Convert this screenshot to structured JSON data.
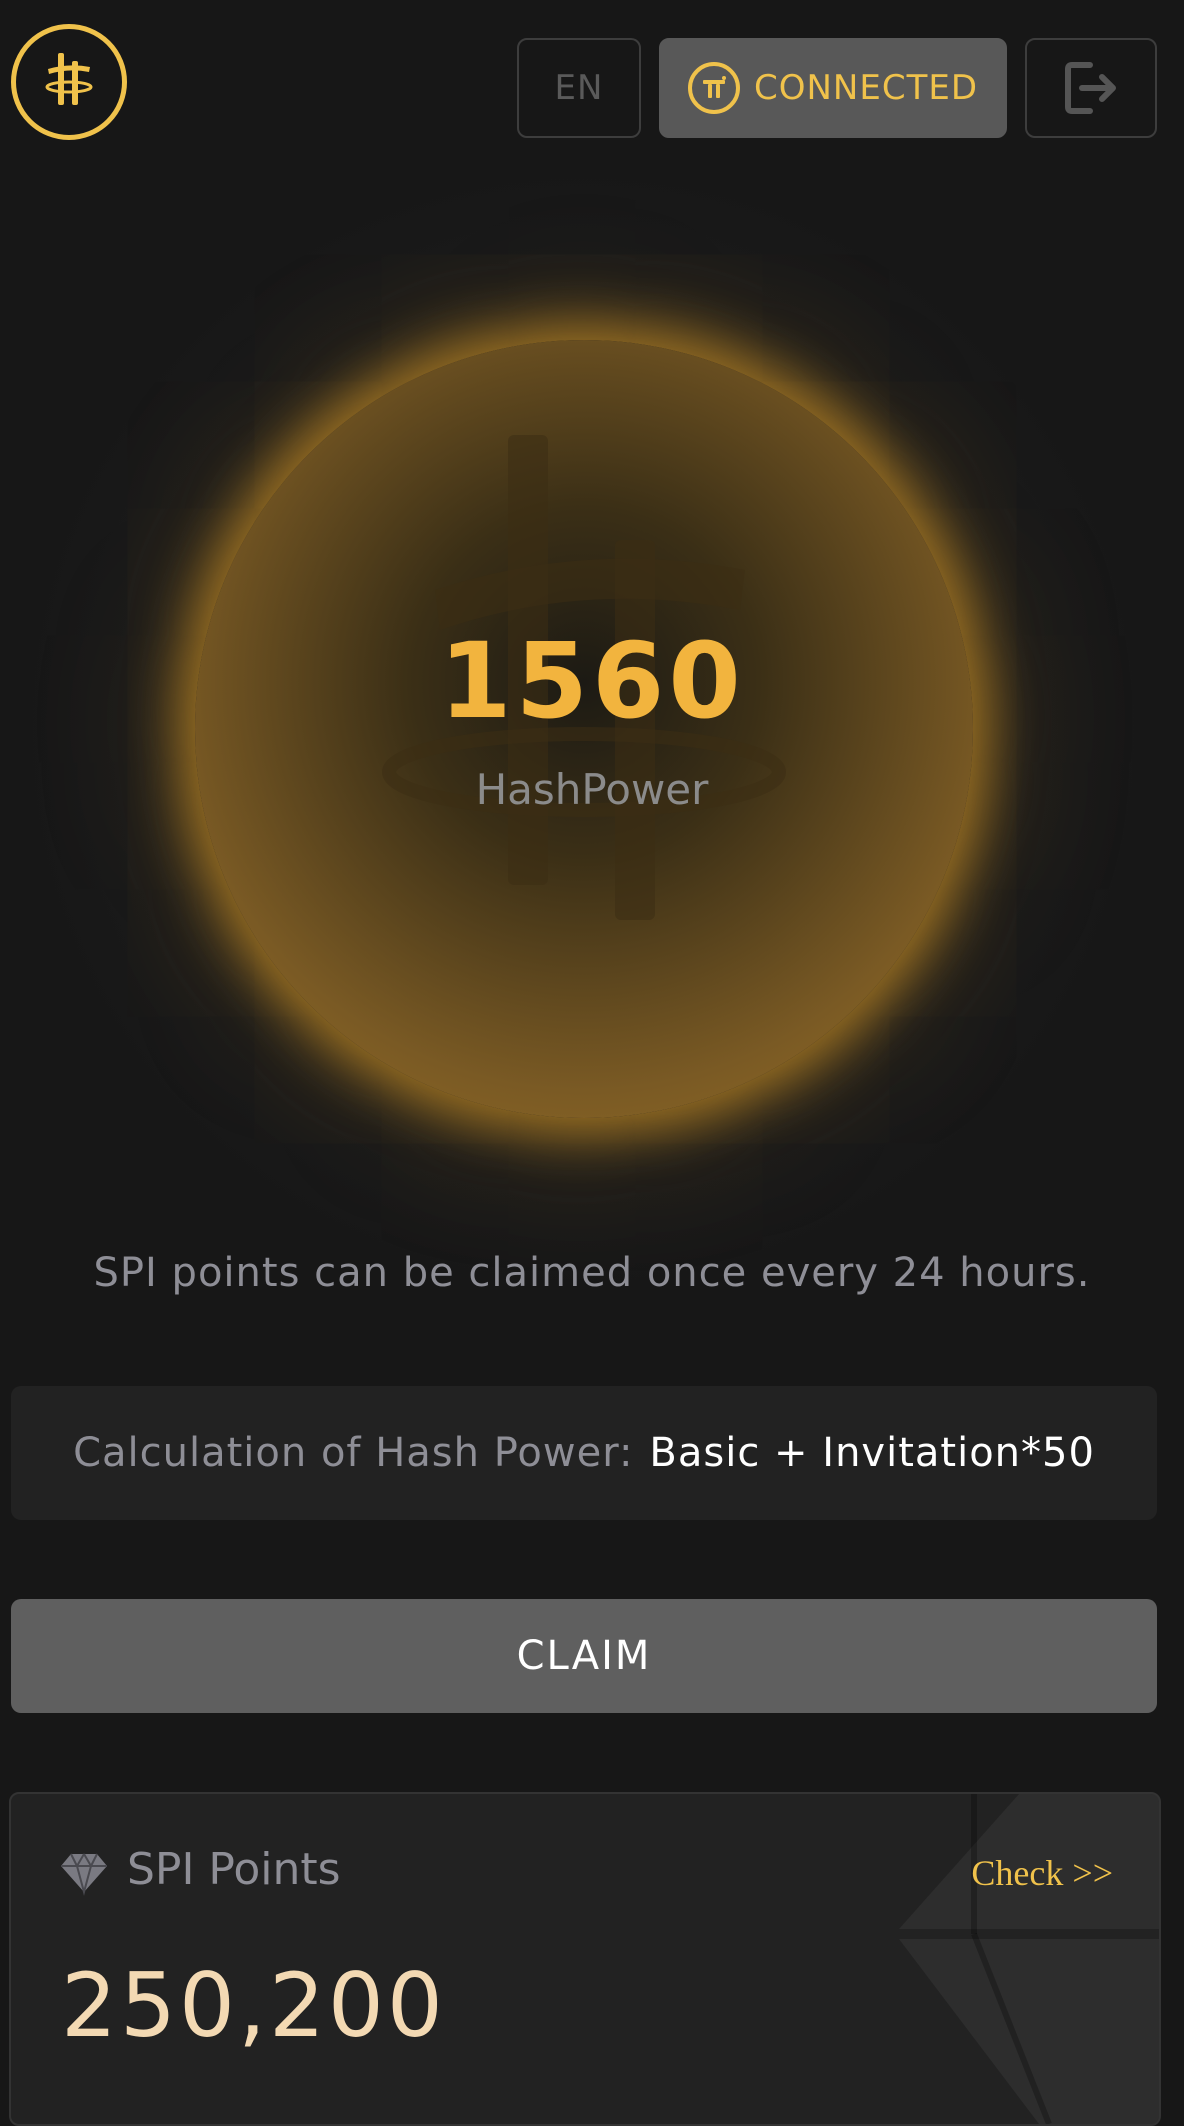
{
  "header": {
    "language_label": "EN",
    "connection_label": "CONNECTED"
  },
  "hash_power": {
    "value": "1560",
    "label": "HashPower"
  },
  "info": {
    "claim_notice": "SPI points can be claimed once every 24 hours."
  },
  "calculation": {
    "label": "Calculation of Hash Power:",
    "formula": "Basic + Invitation*50"
  },
  "claim_button": {
    "label": "CLAIM"
  },
  "points_card": {
    "title": "SPI Points",
    "check_label": "Check >>",
    "value": "250,200"
  },
  "colors": {
    "accent": "#f0c24b",
    "hash_value": "#f2b43e",
    "background": "#171717",
    "points_value": "#f3d9b3"
  },
  "icons": {
    "logo": "pi-trident-logo",
    "connected": "pi-coin-icon",
    "logout": "logout-icon",
    "points": "diamond-icon"
  }
}
